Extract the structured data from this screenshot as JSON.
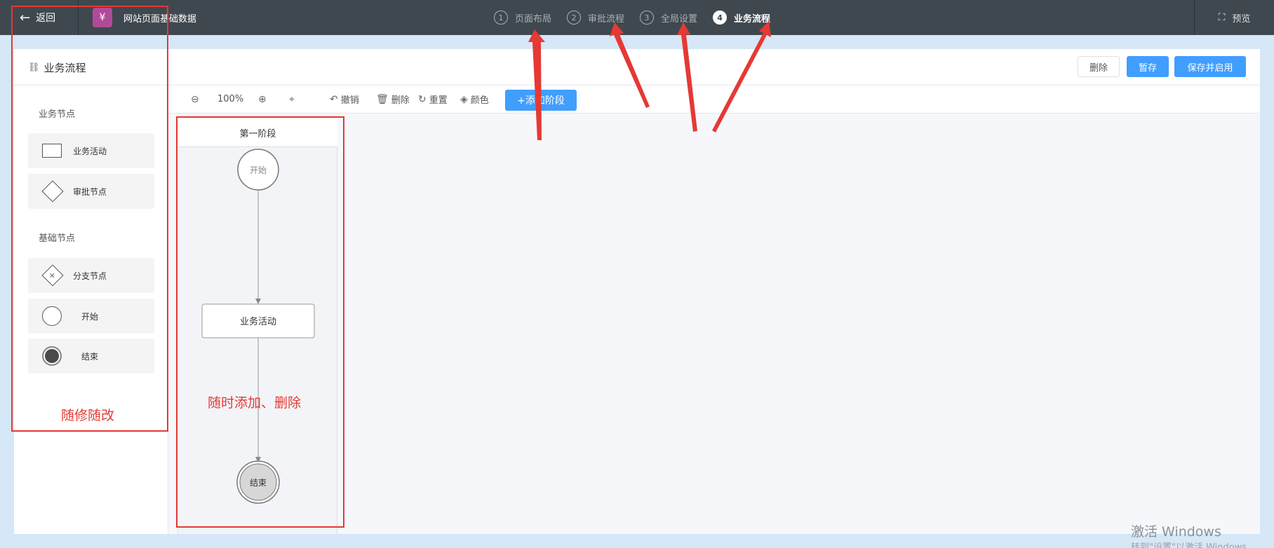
{
  "topbar": {
    "back_label": "返回",
    "back_icon": "arrow-left-icon",
    "app_title": "网站页面基础数据",
    "logo_icon": "money-bag-icon",
    "steps": [
      {
        "num": "1",
        "label": "页面布局",
        "active": false
      },
      {
        "num": "2",
        "label": "审批流程",
        "active": false
      },
      {
        "num": "3",
        "label": "全局设置",
        "active": false
      },
      {
        "num": "4",
        "label": "业务流程",
        "active": true
      }
    ],
    "preview_label": "预览",
    "preview_icon": "fullscreen-icon"
  },
  "card": {
    "title": "业务流程",
    "title_icon": "flow-icon",
    "buttons": {
      "delete": "删除",
      "save_draft": "暂存",
      "save_publish": "保存并启用"
    }
  },
  "sidebar": {
    "business_group": "业务节点",
    "business_items": [
      "业务活动",
      "审批节点"
    ],
    "basic_group": "基础节点",
    "basic_items": [
      "分支节点",
      "开始",
      "结束"
    ]
  },
  "toolbar": {
    "zoom": "100%",
    "undo": "撤销",
    "delete": "删除",
    "reset": "重置",
    "color": "颜色",
    "add_stage": "+添加阶段"
  },
  "canvas": {
    "stage_title": "第一阶段",
    "start_label": "开始",
    "activity_label": "业务活动",
    "end_label": "结束"
  },
  "annotations": {
    "sidebar_note": "随修随改",
    "canvas_note": "随时添加、删除",
    "color": "#e53935"
  },
  "watermark": {
    "line1": "激活 Windows",
    "line2": "转到\"设置\"以激活 Windows。"
  },
  "colors": {
    "topbar": "#3f484f",
    "primary": "#409eff",
    "page_bg": "#d6e7f7"
  }
}
